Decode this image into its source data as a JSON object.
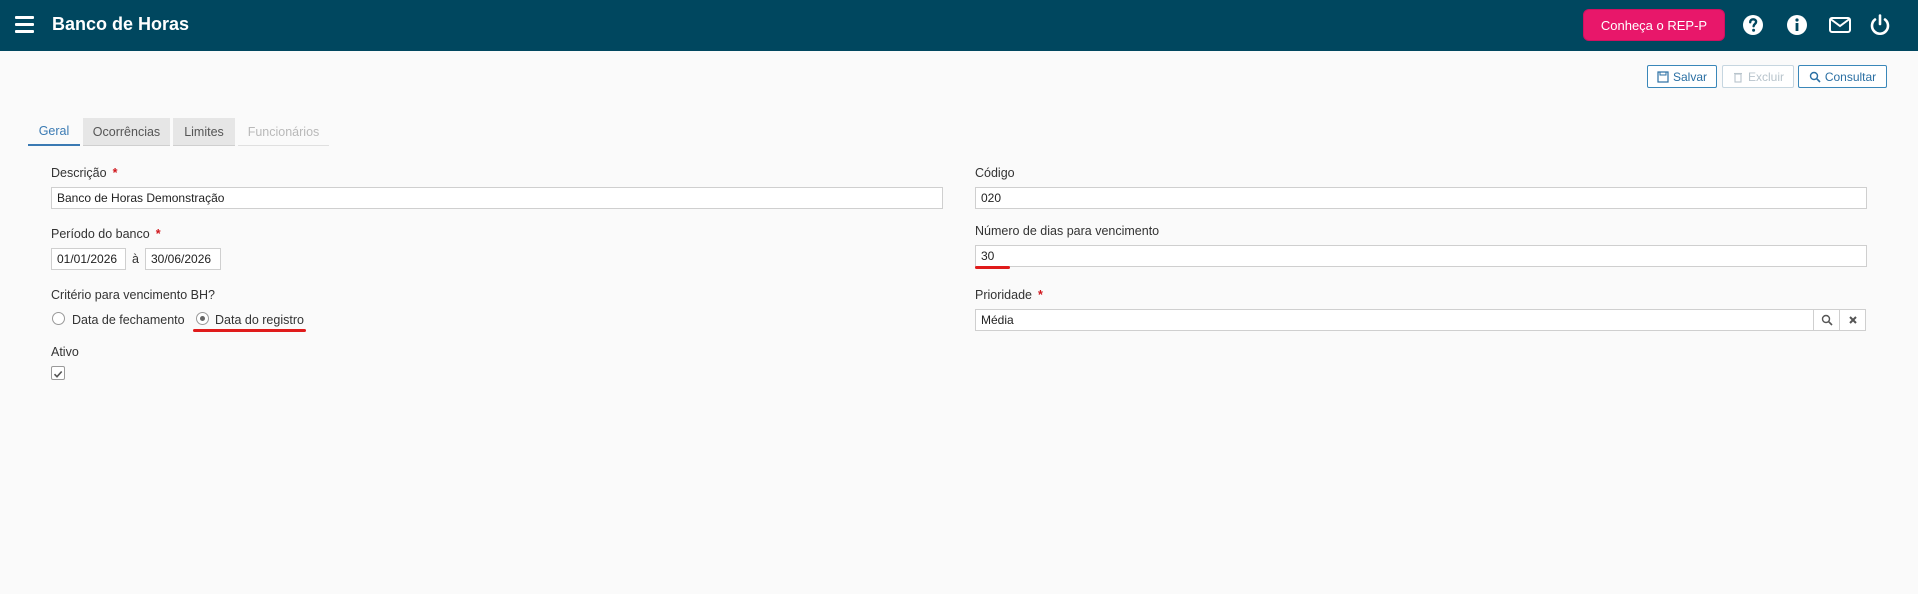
{
  "header": {
    "title": "Banco de Horas",
    "rep_button": "Conheça o REP-P",
    "icons": [
      "menu-icon",
      "help-icon",
      "info-icon",
      "mail-icon",
      "power-icon"
    ]
  },
  "toolbar": {
    "save_label": "Salvar",
    "delete_label": "Excluir",
    "search_label": "Consultar"
  },
  "tabs": [
    {
      "label": "Geral",
      "state": "active"
    },
    {
      "label": "Ocorrências",
      "state": "inactive"
    },
    {
      "label": "Limites",
      "state": "inactive"
    },
    {
      "label": "Funcionários",
      "state": "disabled"
    }
  ],
  "form": {
    "descricao": {
      "label": "Descrição",
      "required": "*",
      "value": "Banco de Horas Demonstração"
    },
    "periodo": {
      "label": "Período do banco",
      "required": "*",
      "start": "01/01/2026",
      "separator": "à",
      "end": "30/06/2026"
    },
    "criterio": {
      "label": "Critério para vencimento BH?",
      "options": [
        {
          "label": "Data de fechamento",
          "checked": false
        },
        {
          "label": "Data do registro",
          "checked": true
        }
      ]
    },
    "ativo": {
      "label": "Ativo",
      "checked": true
    },
    "codigo": {
      "label": "Código",
      "value": "020"
    },
    "dias_vencimento": {
      "label": "Número de dias para vencimento",
      "value": "30"
    },
    "prioridade": {
      "label": "Prioridade",
      "required": "*",
      "value": "Média"
    }
  },
  "colors": {
    "topbar": "#00475f",
    "rep_button": "#e8176a",
    "accent": "#3a7ab3",
    "required": "#d0161c",
    "annotation": "#e01b1b"
  }
}
